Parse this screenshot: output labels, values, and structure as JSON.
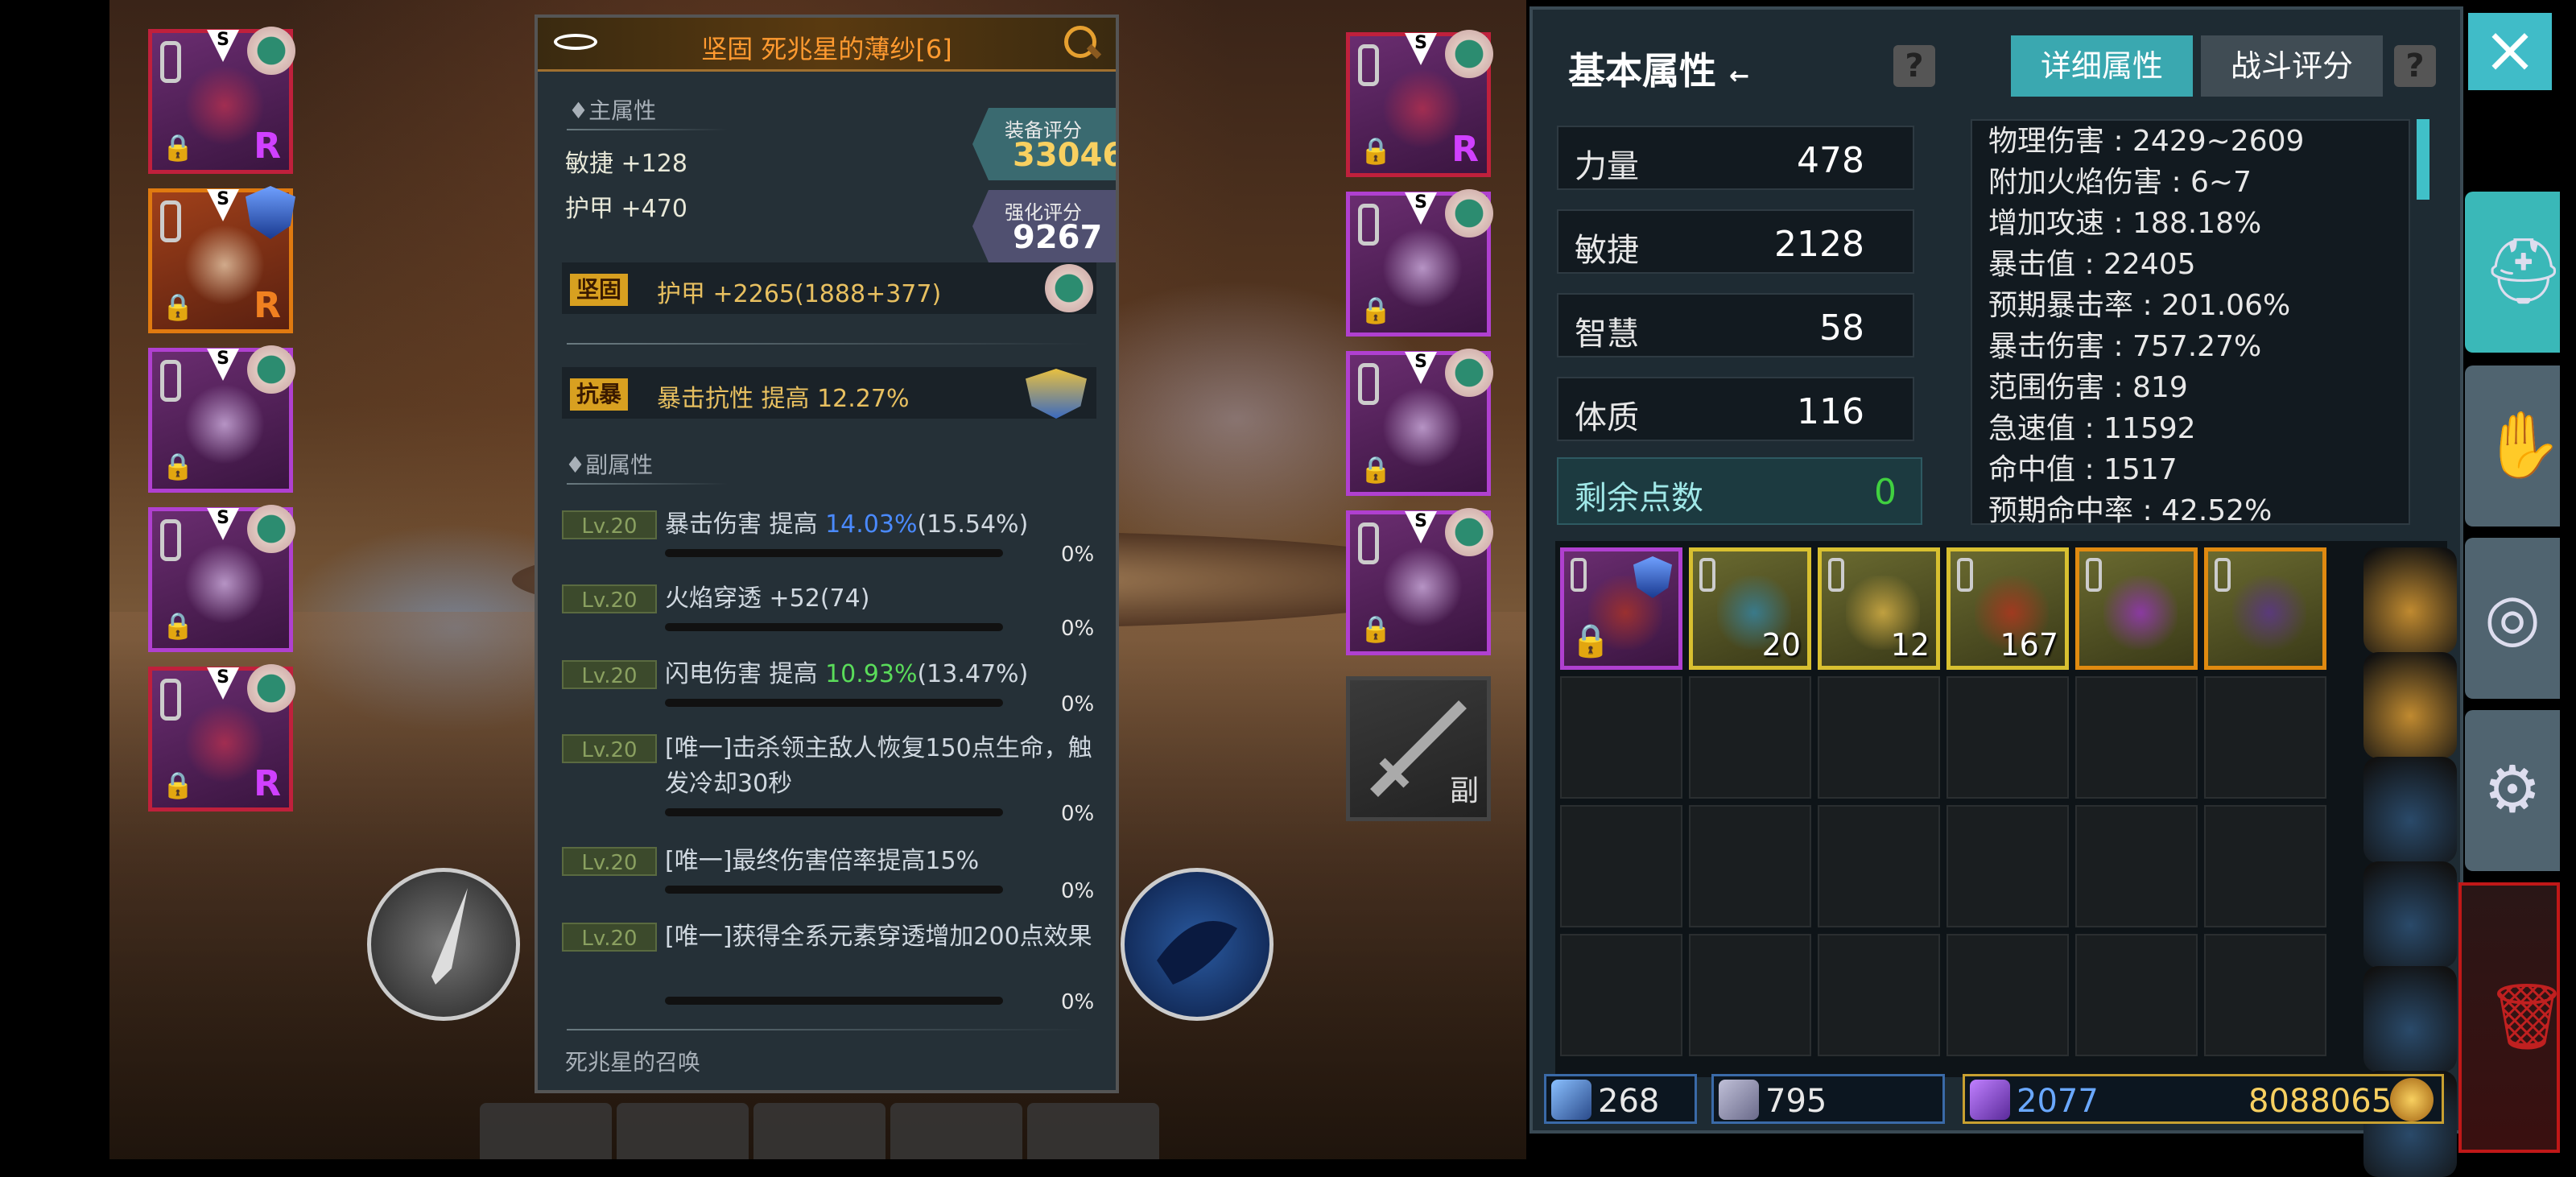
{
  "tooltip": {
    "title": "坚固 死兆星的薄纱[6]",
    "main_section": "♦主属性",
    "main_stats": [
      "敏捷 +128",
      "护甲 +470"
    ],
    "gear_score_label": "装备评分",
    "gear_score": "33046",
    "enhance_score_label": "强化评分",
    "enhance_score": "9267",
    "solid_chip": "坚固",
    "solid_text": "护甲 +2265(1888+377)",
    "crit_chip": "抗暴",
    "crit_text": "暴击抗性 提高 12.27%",
    "sub_section": "♦副属性",
    "sub_stats": [
      {
        "lv": "Lv.20",
        "pre": "暴击伤害 提高 ",
        "hl": "14.03%",
        "post": "(15.54%)",
        "pct": "0%",
        "hl_color": "blue"
      },
      {
        "lv": "Lv.20",
        "pre": "火焰穿透 +52(74)",
        "hl": "",
        "post": "",
        "pct": "0%",
        "hl_color": ""
      },
      {
        "lv": "Lv.20",
        "pre": "闪电伤害 提高 ",
        "hl": "10.93%",
        "post": "(13.47%)",
        "pct": "0%",
        "hl_color": "green"
      },
      {
        "lv": "Lv.20",
        "pre": "[唯一]击杀领主敌人恢复150点生命，触发冷却30秒",
        "hl": "",
        "post": "",
        "pct": "0%",
        "hl_color": ""
      },
      {
        "lv": "Lv.20",
        "pre": "[唯一]最终伤害倍率提高15%",
        "hl": "",
        "post": "",
        "pct": "0%",
        "hl_color": ""
      },
      {
        "lv": "Lv.20",
        "pre": "[唯一]获得全系元素穿透增加200点效果",
        "hl": "",
        "post": "",
        "pct": "0%",
        "hl_color": ""
      }
    ],
    "set_label": "死兆星的召唤"
  },
  "left_equipment": [
    {
      "grade": "S",
      "rank": "R",
      "border": "red",
      "badge": "emblem",
      "rank_color": "#d040ff"
    },
    {
      "grade": "S",
      "rank": "R",
      "border": "orange",
      "badge": "shield",
      "rank_color": "#f08020"
    },
    {
      "grade": "S",
      "rank": "",
      "border": "purple",
      "badge": "emblem",
      "rank_color": ""
    },
    {
      "grade": "S",
      "rank": "",
      "border": "purple",
      "badge": "emblem",
      "rank_color": ""
    },
    {
      "grade": "S",
      "rank": "R",
      "border": "red",
      "badge": "emblem",
      "rank_color": "#d040ff"
    }
  ],
  "right_equipment": [
    {
      "grade": "S",
      "rank": "R",
      "border": "red",
      "badge": "emblem",
      "rank_color": "#d040ff"
    },
    {
      "grade": "S",
      "rank": "",
      "border": "purple",
      "badge": "emblem",
      "rank_color": ""
    },
    {
      "grade": "S",
      "rank": "",
      "border": "purple",
      "badge": "emblem",
      "rank_color": ""
    },
    {
      "grade": "S",
      "rank": "",
      "border": "purple",
      "badge": "emblem",
      "rank_color": ""
    }
  ],
  "offhand_label": "副",
  "panel": {
    "title": "基本属性",
    "title_arrow": "←",
    "help": "?",
    "tab_detail": "详细属性",
    "tab_combat": "战斗评分",
    "attrs": [
      {
        "k": "力量",
        "v": "478"
      },
      {
        "k": "敏捷",
        "v": "2128"
      },
      {
        "k": "智慧",
        "v": "58"
      },
      {
        "k": "体质",
        "v": "116"
      }
    ],
    "remaining_label": "剩余点数",
    "remaining_value": "0",
    "details": [
      "物理伤害 : 2429~2609",
      "附加火焰伤害 : 6~7",
      "增加攻速 : 188.18%",
      "暴击值 : 22405",
      "预期暴击率 : 201.06%",
      "暴击伤害 : 757.27%",
      "范围伤害 : 819",
      "急速值 : 11592",
      "命中值 : 1517",
      "预期命中率 : 42.52%"
    ]
  },
  "inventory": {
    "items": [
      {
        "qty": "",
        "border": "purple",
        "color": "#9a3030"
      },
      {
        "qty": "20",
        "border": "yellow",
        "color": "#3a7a8a"
      },
      {
        "qty": "12",
        "border": "yellow",
        "color": "#c0a040"
      },
      {
        "qty": "167",
        "border": "yellow",
        "color": "#a03a20"
      },
      {
        "qty": "",
        "border": "orange",
        "color": "#8a3aa0"
      },
      {
        "qty": "",
        "border": "orange",
        "color": "#5a3a7a"
      }
    ]
  },
  "currency": {
    "keys": "268",
    "gems": "795",
    "crystals": "2077",
    "gold": "8088065"
  },
  "colors": {
    "accent": "#3ab8b8",
    "gold_text": "#f8d060",
    "teal_value": "#40d040"
  },
  "icons": {
    "close": "×",
    "helmet": "⛑",
    "gloves": "✋",
    "target": "◎",
    "settings": "⚙",
    "trash": "🗑",
    "lock": "🔒"
  }
}
